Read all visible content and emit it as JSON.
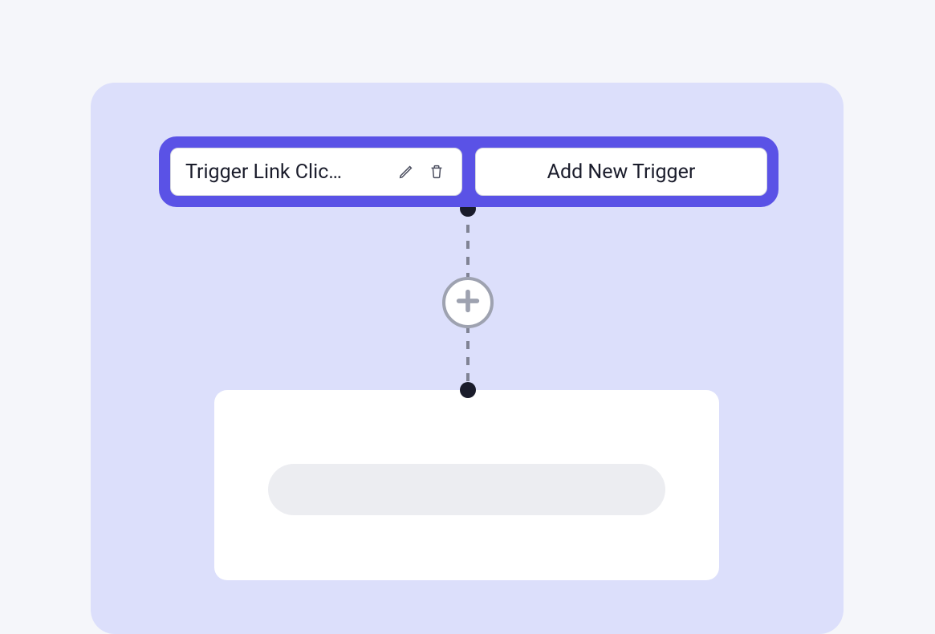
{
  "triggers": {
    "existing": {
      "label": "Trigger Link Clic…"
    },
    "add": {
      "label": "Add New Trigger"
    }
  },
  "icons": {
    "edit": "pencil-icon",
    "delete": "trash-icon",
    "plus": "plus-icon"
  },
  "colors": {
    "canvas_bg": "#dcdffb",
    "accent": "#5a52e6",
    "endpoint": "#1a1c2b",
    "connector": "#808394",
    "placeholder": "#ecedf1"
  }
}
